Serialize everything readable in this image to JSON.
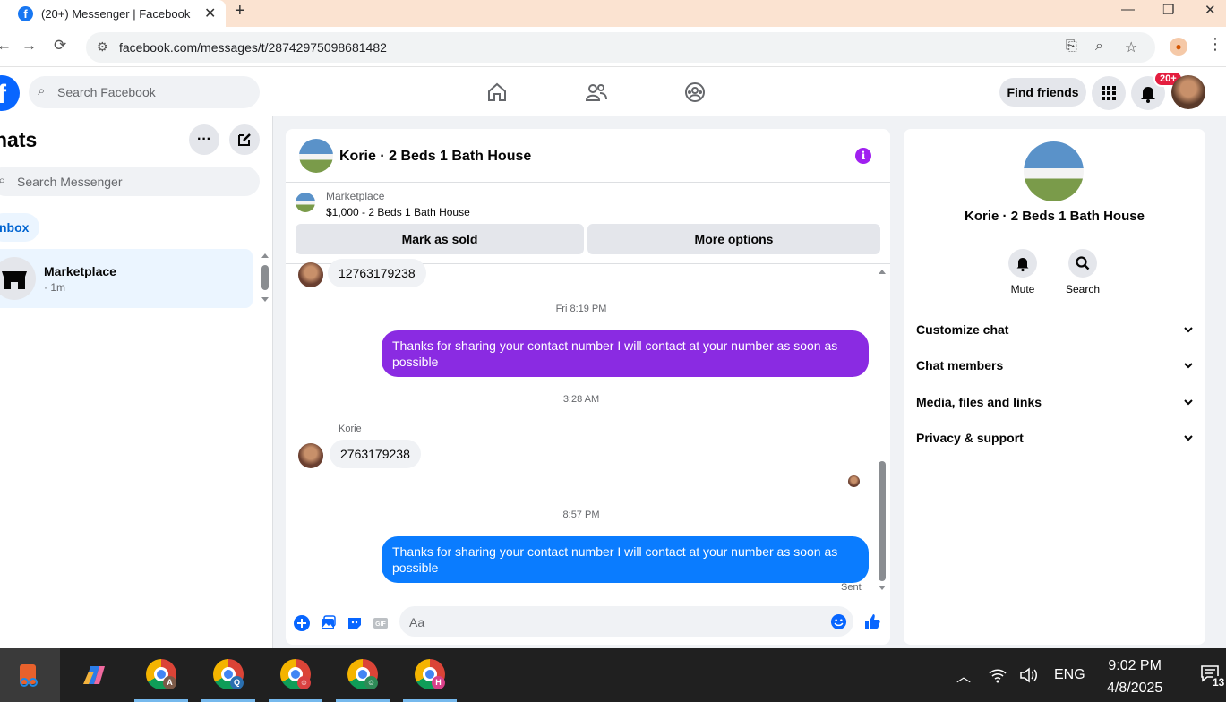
{
  "browser": {
    "tab_title": "(20+) Messenger | Facebook",
    "url": "facebook.com/messages/t/28742975098681482"
  },
  "fb_nav": {
    "search_placeholder": "Search Facebook",
    "find_friends": "Find friends",
    "notification_badge": "20+"
  },
  "chat_list": {
    "title": "hats",
    "search_placeholder": "Search Messenger",
    "filter_tab": "nbox",
    "items": [
      {
        "name": "Marketplace",
        "meta": "· 1m"
      }
    ]
  },
  "conversation": {
    "name": "Korie · 2 Beds 1 Bath House",
    "listing_label": "Marketplace",
    "listing_title": "$1,000 - 2 Beds 1 Bath House",
    "mark_sold": "Mark as sold",
    "more_options": "More options",
    "messages": [
      {
        "dir": "in",
        "text": "12763179238"
      },
      {
        "type": "time",
        "text": "Fri 8:19 PM"
      },
      {
        "dir": "out",
        "color": "#8a2be2",
        "text": "Thanks for sharing your contact number I will contact at your number as soon as possible"
      },
      {
        "type": "time",
        "text": "3:28 AM"
      },
      {
        "dir": "in",
        "sender": "Korie",
        "text": "2763179238"
      },
      {
        "type": "time",
        "text": "8:57 PM"
      },
      {
        "dir": "out",
        "color": "#0a7cff",
        "text": "Thanks for sharing your contact number I will contact at your number as soon as possible"
      }
    ],
    "sent_label": "Sent",
    "composer_placeholder": "Aa"
  },
  "details": {
    "name": "Korie · 2 Beds 1 Bath House",
    "actions": [
      "Mute",
      "Search"
    ],
    "sections": [
      "Customize chat",
      "Chat members",
      "Media, files and links",
      "Privacy & support"
    ]
  },
  "taskbar": {
    "chrome_profiles": [
      "A",
      "Q",
      "",
      "",
      "H"
    ],
    "lang": "ENG",
    "time": "9:02 PM",
    "date": "4/8/2025",
    "notif_count": "13"
  },
  "colors": {
    "fb_blue": "#0866ff",
    "purple_bubble": "#8a2be2",
    "blue_bubble": "#0a7cff",
    "info": "#a020f0"
  },
  "icons": [
    "home-icon",
    "friends-icon",
    "groups-icon",
    "menu-grid-icon",
    "bell-icon",
    "info-icon",
    "plus-icon",
    "image-icon",
    "sticker-icon",
    "gif-icon",
    "emoji-icon",
    "thumbs-up-icon"
  ]
}
